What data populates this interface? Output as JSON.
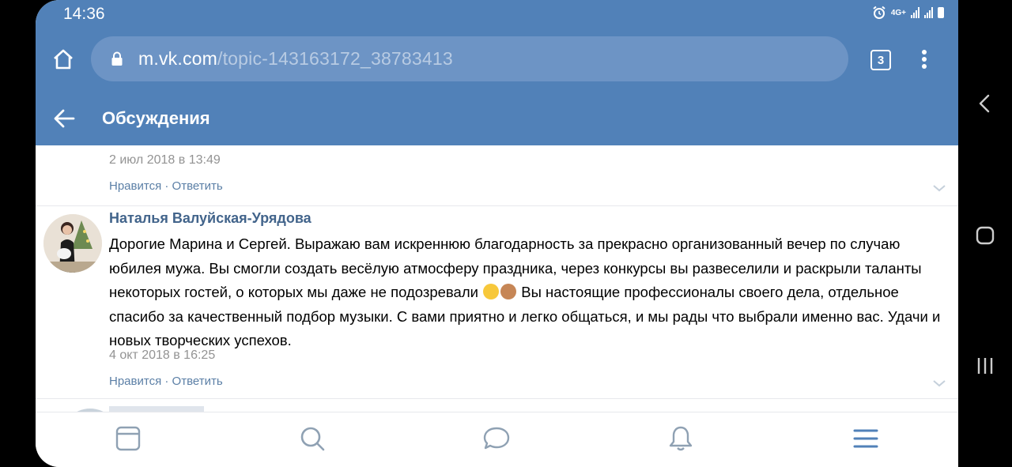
{
  "status_bar": {
    "time": "14:36",
    "network": "4G+"
  },
  "browser": {
    "url_domain": "m.vk.com",
    "url_path": "/topic-143163172_38783413",
    "tabs_count": "3",
    "icons": [
      "home-icon",
      "lock-icon",
      "tabs-icon",
      "more-icon"
    ]
  },
  "header": {
    "title": "Обсуждения"
  },
  "comments": [
    {
      "date": "2 июл 2018 в 13:49",
      "like": "Нравится",
      "sep": " · ",
      "reply": "Ответить"
    },
    {
      "author": "Наталья Валуйская-Урядова",
      "text_before_emoji": "Дорогие Марина и Сергей. Выражаю вам искреннюю благодарность за прекрасно организованный вечер по случаю юбилея мужа. Вы смогли создать весёлую атмосферу праздника, через конкурсы вы развеселили и раскрыли таланты некоторых гостей, о которых мы даже не подозревали",
      "text_after_emoji": " Вы настоящие профессионалы своего дела, отдельное спасибо за качественный подбор музыки. С вами приятно и легко общаться, и мы рады что выбрали именно вас. Удачи и новых творческих успехов.",
      "emojis": [
        "wink-emoji",
        "see-no-evil-monkey-emoji"
      ],
      "date": "4 окт 2018 в 16:25",
      "like": "Нравится",
      "sep": " · ",
      "reply": "Ответить"
    }
  ],
  "bottom_nav": [
    "news-icon",
    "search-icon",
    "messages-icon",
    "notifications-icon",
    "menu-icon"
  ],
  "colors": {
    "accent": "#5181b8",
    "link": "#42648b",
    "action": "#5b7fa6",
    "muted": "#939393"
  }
}
